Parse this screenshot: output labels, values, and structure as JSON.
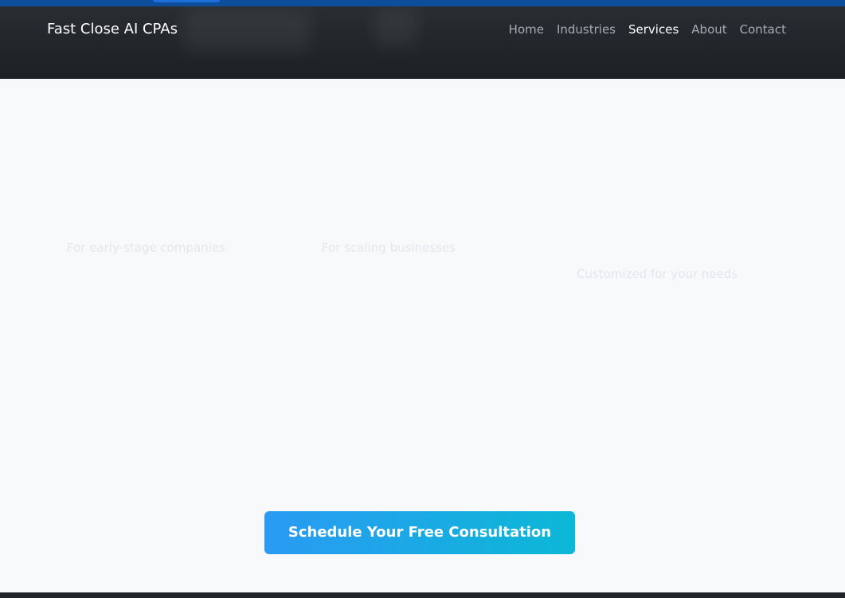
{
  "header": {
    "brand": "Fast Close AI CPAs",
    "nav": [
      {
        "label": "Home",
        "active": false
      },
      {
        "label": "Industries",
        "active": false
      },
      {
        "label": "Services",
        "active": true
      },
      {
        "label": "About",
        "active": false
      },
      {
        "label": "Contact",
        "active": false
      }
    ]
  },
  "plans": [
    {
      "subtitle": "For early-stage companies"
    },
    {
      "subtitle": "For scaling businesses"
    },
    {
      "subtitle": "Customized for your needs"
    }
  ],
  "cta": {
    "label": "Schedule Your Free Consultation"
  },
  "colors": {
    "navbar_bg": "#23262b",
    "top_strip": "#0d4e9c",
    "page_bg": "#f7f9fb",
    "cta_gradient_start": "#2a9af3",
    "cta_gradient_end": "#0bb8d6",
    "nav_link": "#a7abb1",
    "nav_link_active": "#ffffff"
  }
}
